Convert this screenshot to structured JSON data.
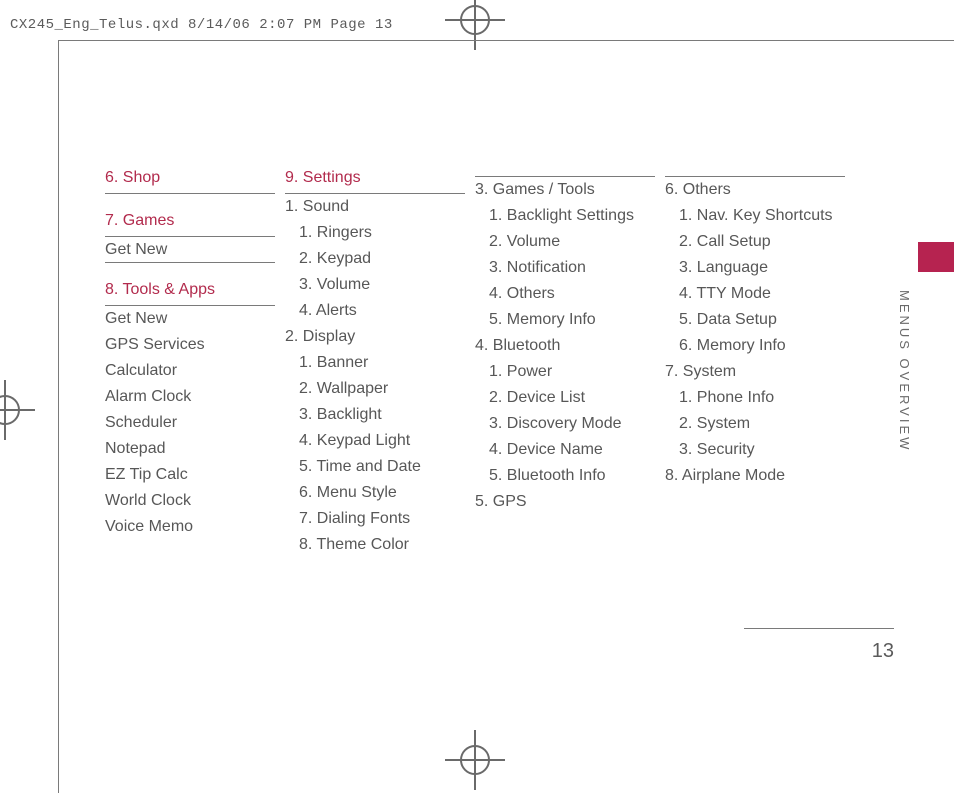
{
  "header": "CX245_Eng_Telus.qxd  8/14/06  2:07 PM  Page 13",
  "side_label": "MENUS OVERVIEW",
  "page_number": "13",
  "columns": {
    "c1": {
      "menu6": "6. Shop",
      "menu7": "7. Games",
      "g1": "Get New",
      "menu8": "8. Tools & Apps",
      "t1": "Get New",
      "t2": "GPS Services",
      "t3": "Calculator",
      "t4": "Alarm Clock",
      "t5": "Scheduler",
      "t6": "Notepad",
      "t7": "EZ Tip Calc",
      "t8": "World Clock",
      "t9": "Voice Memo"
    },
    "c2": {
      "menu9": "9. Settings",
      "s1": "1. Sound",
      "s1a": "1. Ringers",
      "s1b": "2. Keypad",
      "s1c": "3. Volume",
      "s1d": "4. Alerts",
      "s2": "2. Display",
      "s2a": "1. Banner",
      "s2b": "2. Wallpaper",
      "s2c": "3. Backlight",
      "s2d": "4. Keypad Light",
      "s2e": "5. Time and Date",
      "s2f": "6. Menu Style",
      "s2g": "7.  Dialing Fonts",
      "s2h": "8. Theme Color"
    },
    "c3": {
      "s3": "3. Games / Tools",
      "s3a": "1. Backlight Settings",
      "s3b": "2. Volume",
      "s3c": "3. Notification",
      "s3d": "4. Others",
      "s3e": "5. Memory Info",
      "s4": "4. Bluetooth",
      "s4a": "1. Power",
      "s4b": "2. Device List",
      "s4c": "3. Discovery Mode",
      "s4d": "4. Device Name",
      "s4e": "5. Bluetooth Info",
      "s5": "5. GPS"
    },
    "c4": {
      "s6": "6. Others",
      "s6a": "1. Nav. Key Shortcuts",
      "s6b": "2. Call Setup",
      "s6c": "3. Language",
      "s6d": "4. TTY Mode",
      "s6e": "5. Data Setup",
      "s6f": "6. Memory Info",
      "s7": "7.  System",
      "s7a": "1. Phone Info",
      "s7b": "2. System",
      "s7c": "3. Security",
      "s8": "8. Airplane Mode"
    }
  }
}
